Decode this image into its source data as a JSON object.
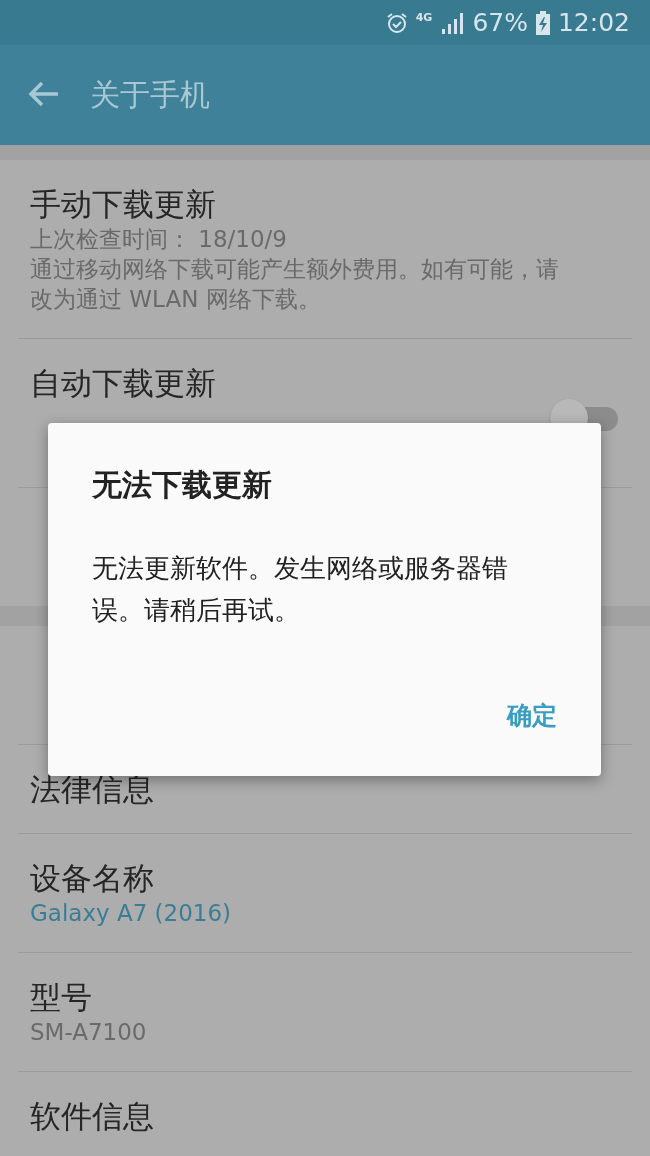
{
  "status_bar": {
    "network": "4G",
    "battery": "67%",
    "time": "12:02"
  },
  "app_bar": {
    "title": "关于手机"
  },
  "sections": [
    {
      "items": [
        {
          "title": "手动下载更新",
          "lines": [
            {
              "text": "上次检查时间： 18/10/9",
              "kind": "summary"
            },
            {
              "text": "通过移动网络下载可能产生额外费用。如有可能，请",
              "kind": "summary"
            },
            {
              "text": "改为通过 WLAN 网络下载。",
              "kind": "summary"
            }
          ]
        },
        {
          "title": "自动下载更新",
          "lines": [
            {
              "kind": "covered"
            },
            {
              "kind": "covered"
            }
          ],
          "switch": {
            "on": false
          }
        },
        {
          "kind": "covered",
          "lines": [
            {
              "kind": "covered"
            }
          ]
        }
      ]
    },
    {
      "items": [
        {
          "kind": "covered",
          "lines": [
            {
              "kind": "covered"
            }
          ]
        },
        {
          "title": "法律信息"
        },
        {
          "title": "设备名称",
          "lines": [
            {
              "text": "Galaxy A7 (2016)",
              "kind": "value"
            }
          ]
        },
        {
          "title": "型号",
          "lines": [
            {
              "text": "SM-A7100",
              "kind": "summary"
            }
          ]
        },
        {
          "title": "软件信息"
        }
      ]
    }
  ],
  "dialog": {
    "title": "无法下载更新",
    "message": "无法更新软件。发生网络或服务器错误。请稍后再试。",
    "buttons": [
      "确定"
    ]
  }
}
